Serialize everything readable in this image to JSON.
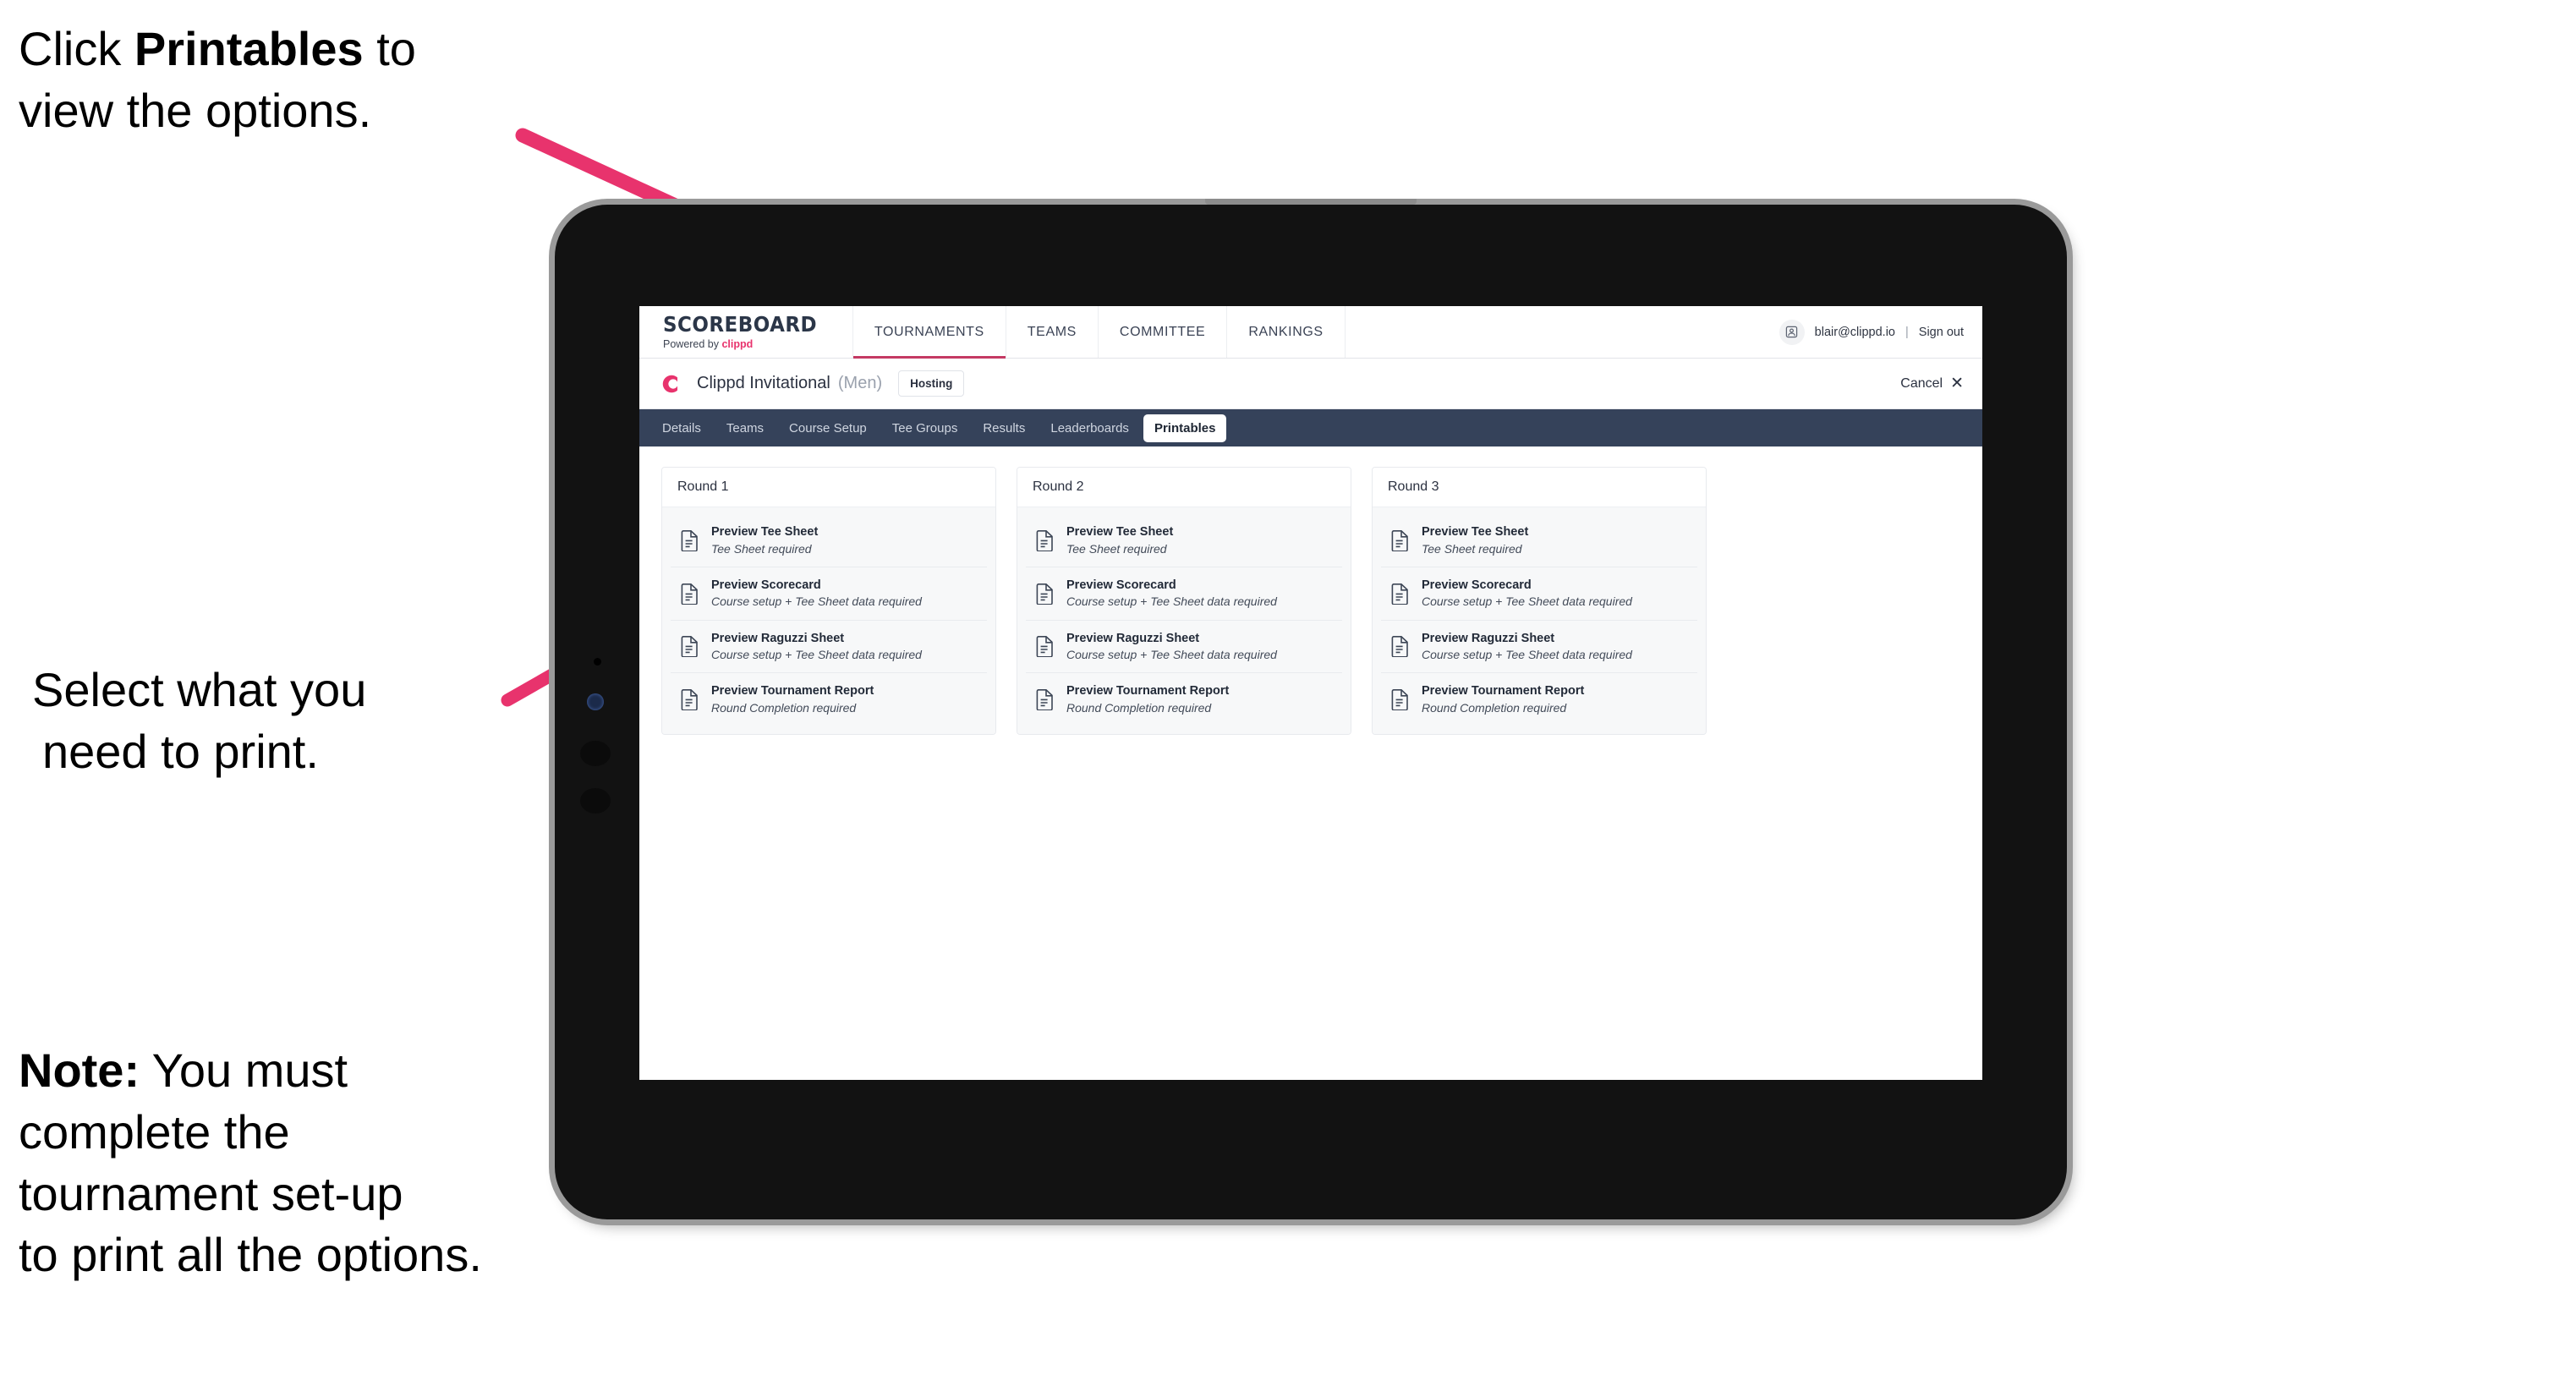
{
  "annotations": {
    "top": {
      "pre": "Click ",
      "bold": "Printables",
      "post": " to",
      "line2": "view the options."
    },
    "middle": {
      "line1": "Select what you",
      "line2": "need to print."
    },
    "note": {
      "label": "Note:",
      "line1_rest": " You must",
      "line2": "complete the",
      "line3": "tournament set-up",
      "line4": "to print all the options."
    }
  },
  "colors": {
    "arrow_pink": "#e8336d",
    "brand_pink": "#e8336d",
    "tabbar_dark": "#35425a",
    "nav_underline": "#c43a63"
  },
  "appbar": {
    "brand_main": "SCOREBOARD",
    "brand_sub_prefix": "Powered by ",
    "brand_sub_name": "clippd",
    "nav": [
      {
        "label": "TOURNAMENTS",
        "active": true
      },
      {
        "label": "TEAMS",
        "active": false
      },
      {
        "label": "COMMITTEE",
        "active": false
      },
      {
        "label": "RANKINGS",
        "active": false
      }
    ],
    "avatar_icon": "user-avatar-icon",
    "user_email": "blair@clippd.io",
    "separator": "|",
    "sign_out": "Sign out"
  },
  "tournament_bar": {
    "logo_letter": "C",
    "title": "Clippd Invitational",
    "gender": "(Men)",
    "status_chip": "Hosting",
    "cancel_label": "Cancel",
    "cancel_icon": "close-x-icon"
  },
  "tabs": [
    {
      "label": "Details",
      "active": false
    },
    {
      "label": "Teams",
      "active": false
    },
    {
      "label": "Course Setup",
      "active": false
    },
    {
      "label": "Tee Groups",
      "active": false
    },
    {
      "label": "Results",
      "active": false
    },
    {
      "label": "Leaderboards",
      "active": false
    },
    {
      "label": "Printables",
      "active": true
    }
  ],
  "rounds": [
    {
      "heading": "Round 1",
      "items": [
        {
          "title": "Preview Tee Sheet",
          "subtitle": "Tee Sheet required"
        },
        {
          "title": "Preview Scorecard",
          "subtitle": "Course setup + Tee Sheet data required"
        },
        {
          "title": "Preview Raguzzi Sheet",
          "subtitle": "Course setup + Tee Sheet data required"
        },
        {
          "title": "Preview Tournament Report",
          "subtitle": "Round Completion required"
        }
      ]
    },
    {
      "heading": "Round 2",
      "items": [
        {
          "title": "Preview Tee Sheet",
          "subtitle": "Tee Sheet required"
        },
        {
          "title": "Preview Scorecard",
          "subtitle": "Course setup + Tee Sheet data required"
        },
        {
          "title": "Preview Raguzzi Sheet",
          "subtitle": "Course setup + Tee Sheet data required"
        },
        {
          "title": "Preview Tournament Report",
          "subtitle": "Round Completion required"
        }
      ]
    },
    {
      "heading": "Round 3",
      "items": [
        {
          "title": "Preview Tee Sheet",
          "subtitle": "Tee Sheet required"
        },
        {
          "title": "Preview Scorecard",
          "subtitle": "Course setup + Tee Sheet data required"
        },
        {
          "title": "Preview Raguzzi Sheet",
          "subtitle": "Course setup + Tee Sheet data required"
        },
        {
          "title": "Preview Tournament Report",
          "subtitle": "Round Completion required"
        }
      ]
    }
  ]
}
